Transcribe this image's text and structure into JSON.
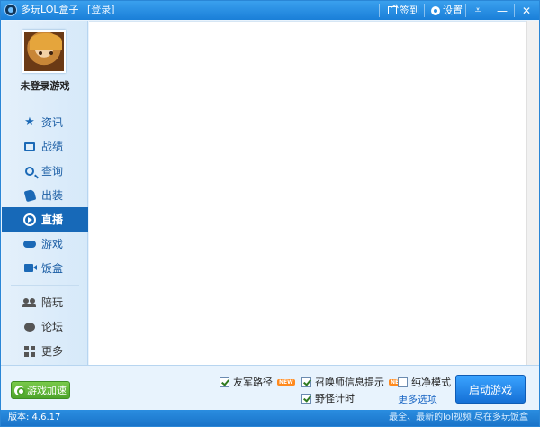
{
  "titlebar": {
    "title": "多玩LOL盒子",
    "login": "[登录]",
    "checkin": "签到",
    "settings": "设置",
    "dropdown_glyph": "⩡",
    "minimize_glyph": "—",
    "close_glyph": "✕"
  },
  "sidebar": {
    "username": "未登录游戏",
    "items": [
      {
        "label": "资讯",
        "icon": "star-icon"
      },
      {
        "label": "战绩",
        "icon": "stats-icon"
      },
      {
        "label": "查询",
        "icon": "search-icon"
      },
      {
        "label": "出装",
        "icon": "equipment-icon"
      },
      {
        "label": "直播",
        "icon": "play-icon",
        "active": true
      },
      {
        "label": "游戏",
        "icon": "gamepad-icon"
      },
      {
        "label": "饭盒",
        "icon": "video-icon"
      },
      {
        "label": "陪玩",
        "icon": "companion-icon"
      },
      {
        "label": "论坛",
        "icon": "forum-icon"
      },
      {
        "label": "更多",
        "icon": "grid-icon"
      }
    ]
  },
  "bottombar": {
    "speed_button": "游戏加速",
    "options": {
      "ally_path": {
        "label": "友军路径",
        "checked": true,
        "badge": "NEW"
      },
      "summoner_tips": {
        "label": "召唤师信息提示",
        "checked": true,
        "badge": "NEW"
      },
      "pure_mode": {
        "label": "纯净模式",
        "checked": false
      },
      "jungle_timer": {
        "label": "野怪计时",
        "checked": true
      }
    },
    "more_options": "更多选项",
    "launch_button": "启动游戏"
  },
  "statusbar": {
    "version": "版本: 4.6.17",
    "ticker": "最全、最新的lol视频 尽在多玩饭盒"
  },
  "colors": {
    "accent": "#1769b8",
    "titlebar": "#1a7fd8",
    "speed_green": "#4da42a",
    "badge_orange": "#ff8a1e"
  }
}
